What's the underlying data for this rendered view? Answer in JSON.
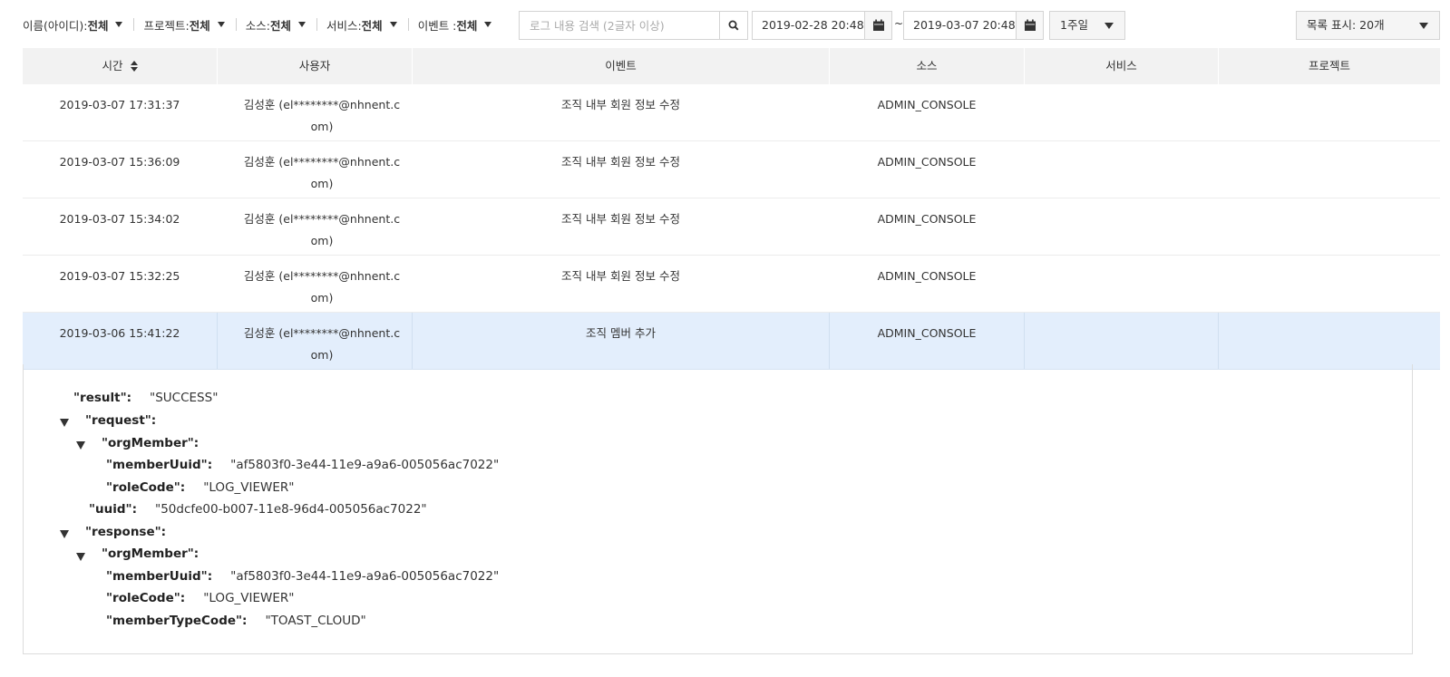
{
  "filters": [
    {
      "label": "이름(아이디):",
      "value": "전체"
    },
    {
      "label": "프로젝트:",
      "value": "전체"
    },
    {
      "label": "소스:",
      "value": "전체"
    },
    {
      "label": "서비스:",
      "value": "전체"
    },
    {
      "label": "이벤트 :",
      "value": "전체"
    }
  ],
  "search": {
    "placeholder": "로그 내용 검색 (2글자 이상)"
  },
  "date_range": {
    "start": "2019-02-28 20:48",
    "separator": "~",
    "end": "2019-03-07 20:48"
  },
  "period_select": {
    "value": "1주일"
  },
  "page_size_select": {
    "value": "목록 표시: 20개"
  },
  "table": {
    "columns": [
      "시간",
      "사용자",
      "이벤트",
      "소스",
      "서비스",
      "프로젝트"
    ],
    "rows": [
      {
        "time": "2019-03-07 17:31:37",
        "user": "김성훈 (el********@nhnent.com)",
        "event": "조직 내부 회원 정보 수정",
        "source": "ADMIN_CONSOLE",
        "service": "",
        "project": ""
      },
      {
        "time": "2019-03-07 15:36:09",
        "user": "김성훈 (el********@nhnent.com)",
        "event": "조직 내부 회원 정보 수정",
        "source": "ADMIN_CONSOLE",
        "service": "",
        "project": ""
      },
      {
        "time": "2019-03-07 15:34:02",
        "user": "김성훈 (el********@nhnent.com)",
        "event": "조직 내부 회원 정보 수정",
        "source": "ADMIN_CONSOLE",
        "service": "",
        "project": ""
      },
      {
        "time": "2019-03-07 15:32:25",
        "user": "김성훈 (el********@nhnent.com)",
        "event": "조직 내부 회원 정보 수정",
        "source": "ADMIN_CONSOLE",
        "service": "",
        "project": ""
      },
      {
        "time": "2019-03-06 15:41:22",
        "user": "김성훈 (el********@nhnent.com)",
        "event": "조직 멤버 추가",
        "source": "ADMIN_CONSOLE",
        "service": "",
        "project": ""
      }
    ]
  },
  "detail": {
    "result": {
      "key": "\"result\":",
      "value": "\"SUCCESS\""
    },
    "request": {
      "key": "\"request\":"
    },
    "request_orgMember": {
      "key": "\"orgMember\":"
    },
    "request_memberUuid": {
      "key": "\"memberUuid\":",
      "value": "\"af5803f0-3e44-11e9-a9a6-005056ac7022\""
    },
    "request_roleCode": {
      "key": "\"roleCode\":",
      "value": "\"LOG_VIEWER\""
    },
    "request_uuid": {
      "key": "\"uuid\":",
      "value": "\"50dcfe00-b007-11e8-96d4-005056ac7022\""
    },
    "response": {
      "key": "\"response\":"
    },
    "response_orgMember": {
      "key": "\"orgMember\":"
    },
    "response_memberUuid": {
      "key": "\"memberUuid\":",
      "value": "\"af5803f0-3e44-11e9-a9a6-005056ac7022\""
    },
    "response_roleCode": {
      "key": "\"roleCode\":",
      "value": "\"LOG_VIEWER\""
    },
    "response_memberTypeCode": {
      "key": "\"memberTypeCode\":",
      "value": "\"TOAST_CLOUD\""
    }
  }
}
